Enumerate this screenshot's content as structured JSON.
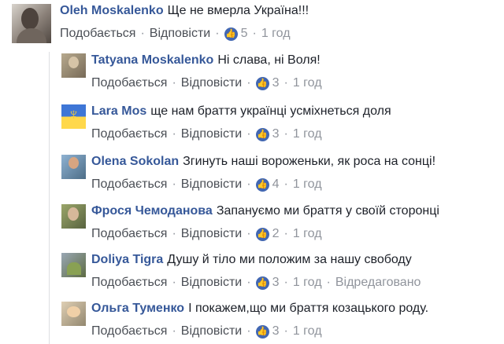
{
  "main_comment": {
    "author": "Oleh Moskalenko",
    "text": "Ще не вмерла Україна!!!",
    "like_label": "Подобається",
    "reply_label": "Відповісти",
    "like_count": "5",
    "time": "1 год"
  },
  "replies": [
    {
      "author": "Tatyana Moskalenko",
      "text": "Ні слава, ні Воля!",
      "like_label": "Подобається",
      "reply_label": "Відповісти",
      "like_count": "3",
      "time": "1 год"
    },
    {
      "author": "Lara Mos",
      "text": "ще нам браття українці усміхнеться доля",
      "like_label": "Подобається",
      "reply_label": "Відповісти",
      "like_count": "3",
      "time": "1 год"
    },
    {
      "author": "Olena Sokolan",
      "text": "Згинуть наші вороженьки, як роса на сонці!",
      "like_label": "Подобається",
      "reply_label": "Відповісти",
      "like_count": "4",
      "time": "1 год"
    },
    {
      "author": "Фрося Чемоданова",
      "text": "Запануємо ми браття у своїй сторонці",
      "like_label": "Подобається",
      "reply_label": "Відповісти",
      "like_count": "2",
      "time": "1 год"
    },
    {
      "author": "Doliya Tigra",
      "text": "Душу й тіло ми положим за нашу свободу",
      "like_label": "Подобається",
      "reply_label": "Відповісти",
      "like_count": "3",
      "time": "1 год",
      "edited": "Відредаговано"
    },
    {
      "author": "Ольга Туменко",
      "text": "І покажем,що ми браття козацького роду.",
      "like_label": "Подобається",
      "reply_label": "Відповісти",
      "like_count": "3",
      "time": "1 год"
    }
  ],
  "icons": {
    "like": "thumbs-up-icon"
  },
  "colors": {
    "author": "#365899",
    "meta": "#90949c",
    "like_badge": "#4267b2",
    "thread_line": "#dddfe2"
  }
}
